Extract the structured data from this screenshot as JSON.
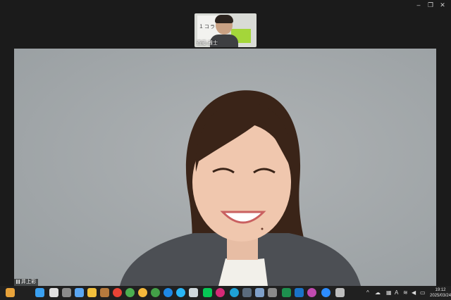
{
  "window_controls": {
    "minimize": "–",
    "maximize": "❐",
    "close": "✕"
  },
  "thumbnail": {
    "participant_name": "斎藤 雅士",
    "board_text": "１コラ"
  },
  "main_video": {
    "participant_name": "井上彩"
  },
  "taskbar": {
    "pinned_apps": [
      {
        "name": "paint-app-icon",
        "color": "#e8a33b"
      },
      {
        "name": "start-button-icon",
        "color": "#3aa0f0"
      },
      {
        "name": "search-icon",
        "color": "#e0e0e0"
      },
      {
        "name": "task-view-icon",
        "color": "#8b8b8b"
      },
      {
        "name": "copilot-icon",
        "color": "#5aa6f2"
      },
      {
        "name": "file-explorer-icon",
        "color": "#f2c03c"
      },
      {
        "name": "game-app-icon",
        "color": "#b67a3d"
      },
      {
        "name": "chrome-icon",
        "color": "#e94335"
      },
      {
        "name": "chrome-profile-1-icon",
        "color": "#4caf50"
      },
      {
        "name": "chrome-profile-2-icon",
        "color": "#f6b93b"
      },
      {
        "name": "chrome-profile-3-icon",
        "color": "#43a047"
      },
      {
        "name": "chrome-profile-4-icon",
        "color": "#1e88e5"
      },
      {
        "name": "chrome-profile-5-icon",
        "color": "#29b6f6"
      },
      {
        "name": "remote-desktop-icon",
        "color": "#cfd8dc"
      },
      {
        "name": "line-app-icon",
        "color": "#06c755"
      },
      {
        "name": "instagram-icon",
        "color": "#d62976"
      },
      {
        "name": "edge-icon",
        "color": "#1fa2d6"
      },
      {
        "name": "calculator-icon",
        "color": "#5a6b7c"
      },
      {
        "name": "snipping-tool-icon",
        "color": "#7fa0c8"
      },
      {
        "name": "store-icon",
        "color": "#8a8a8a"
      },
      {
        "name": "excel-icon",
        "color": "#1d8f4e"
      },
      {
        "name": "outlook-icon",
        "color": "#1a73c8"
      },
      {
        "name": "photos-icon",
        "color": "#c04ab0"
      },
      {
        "name": "zoom-icon",
        "color": "#2d8cff"
      },
      {
        "name": "more-apps-icon",
        "color": "#bdbdbd"
      }
    ],
    "tray": {
      "chevron": "^",
      "onedrive": "☁",
      "font_indicator": "A",
      "clock_time": "19:12",
      "clock_date": "2025/03/24"
    }
  }
}
